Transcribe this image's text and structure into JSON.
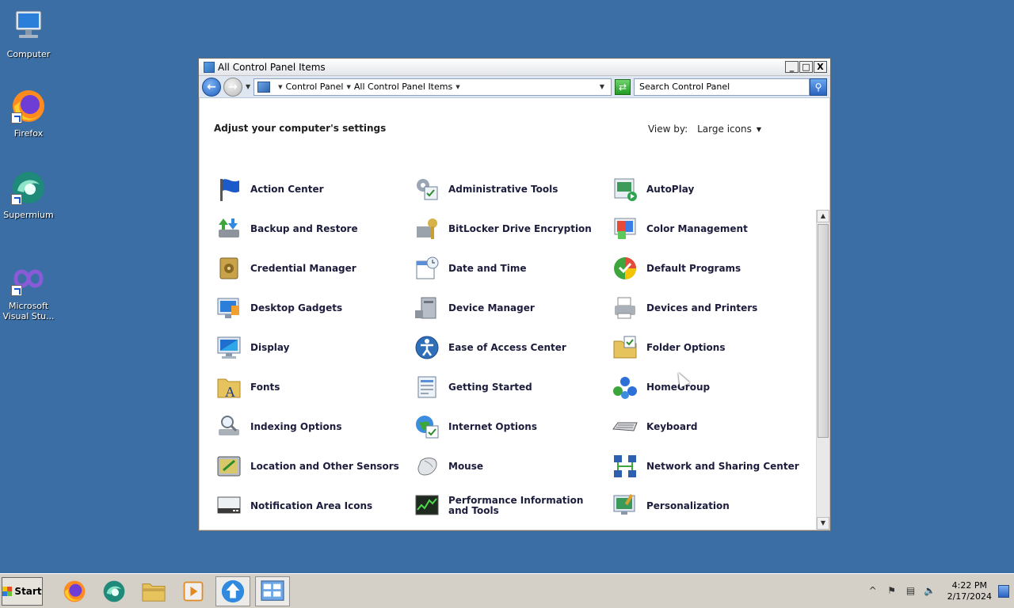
{
  "desktop": {
    "icons": [
      {
        "label": "Computer",
        "icon": "computer-icon"
      },
      {
        "label": "Firefox",
        "icon": "firefox-icon"
      },
      {
        "label": "Supermium",
        "icon": "supermium-icon"
      },
      {
        "label": "Microsoft Visual Stu...",
        "icon": "visual-studio-icon"
      }
    ]
  },
  "window": {
    "title": "All Control Panel Items",
    "buttons": {
      "minimize": "_",
      "maximize": "□",
      "close": "X"
    },
    "address": {
      "crumbs": [
        "Control Panel",
        "All Control Panel Items"
      ],
      "search_placeholder": "Search Control Panel"
    },
    "heading": "Adjust your computer's settings",
    "view_by": {
      "label": "View by:",
      "value": "Large icons"
    },
    "items": [
      [
        "Action Center",
        "Administrative Tools",
        "AutoPlay"
      ],
      [
        "Backup and Restore",
        "BitLocker Drive Encryption",
        "Color Management"
      ],
      [
        "Credential Manager",
        "Date and Time",
        "Default Programs"
      ],
      [
        "Desktop Gadgets",
        "Device Manager",
        "Devices and Printers"
      ],
      [
        "Display",
        "Ease of Access Center",
        "Folder Options"
      ],
      [
        "Fonts",
        "Getting Started",
        "HomeGroup"
      ],
      [
        "Indexing Options",
        "Internet Options",
        "Keyboard"
      ],
      [
        "Location and Other Sensors",
        "Mouse",
        "Network and Sharing Center"
      ],
      [
        "Notification Area Icons",
        "Performance Information and Tools",
        "Personalization"
      ]
    ]
  },
  "taskbar": {
    "start_label": "Start",
    "clock_time": "4:22 PM",
    "clock_date": "2/17/2024",
    "tray_expand": "^"
  },
  "colors": {
    "desktop": "#3a6ea5",
    "item_text": "#1c1c3c"
  }
}
